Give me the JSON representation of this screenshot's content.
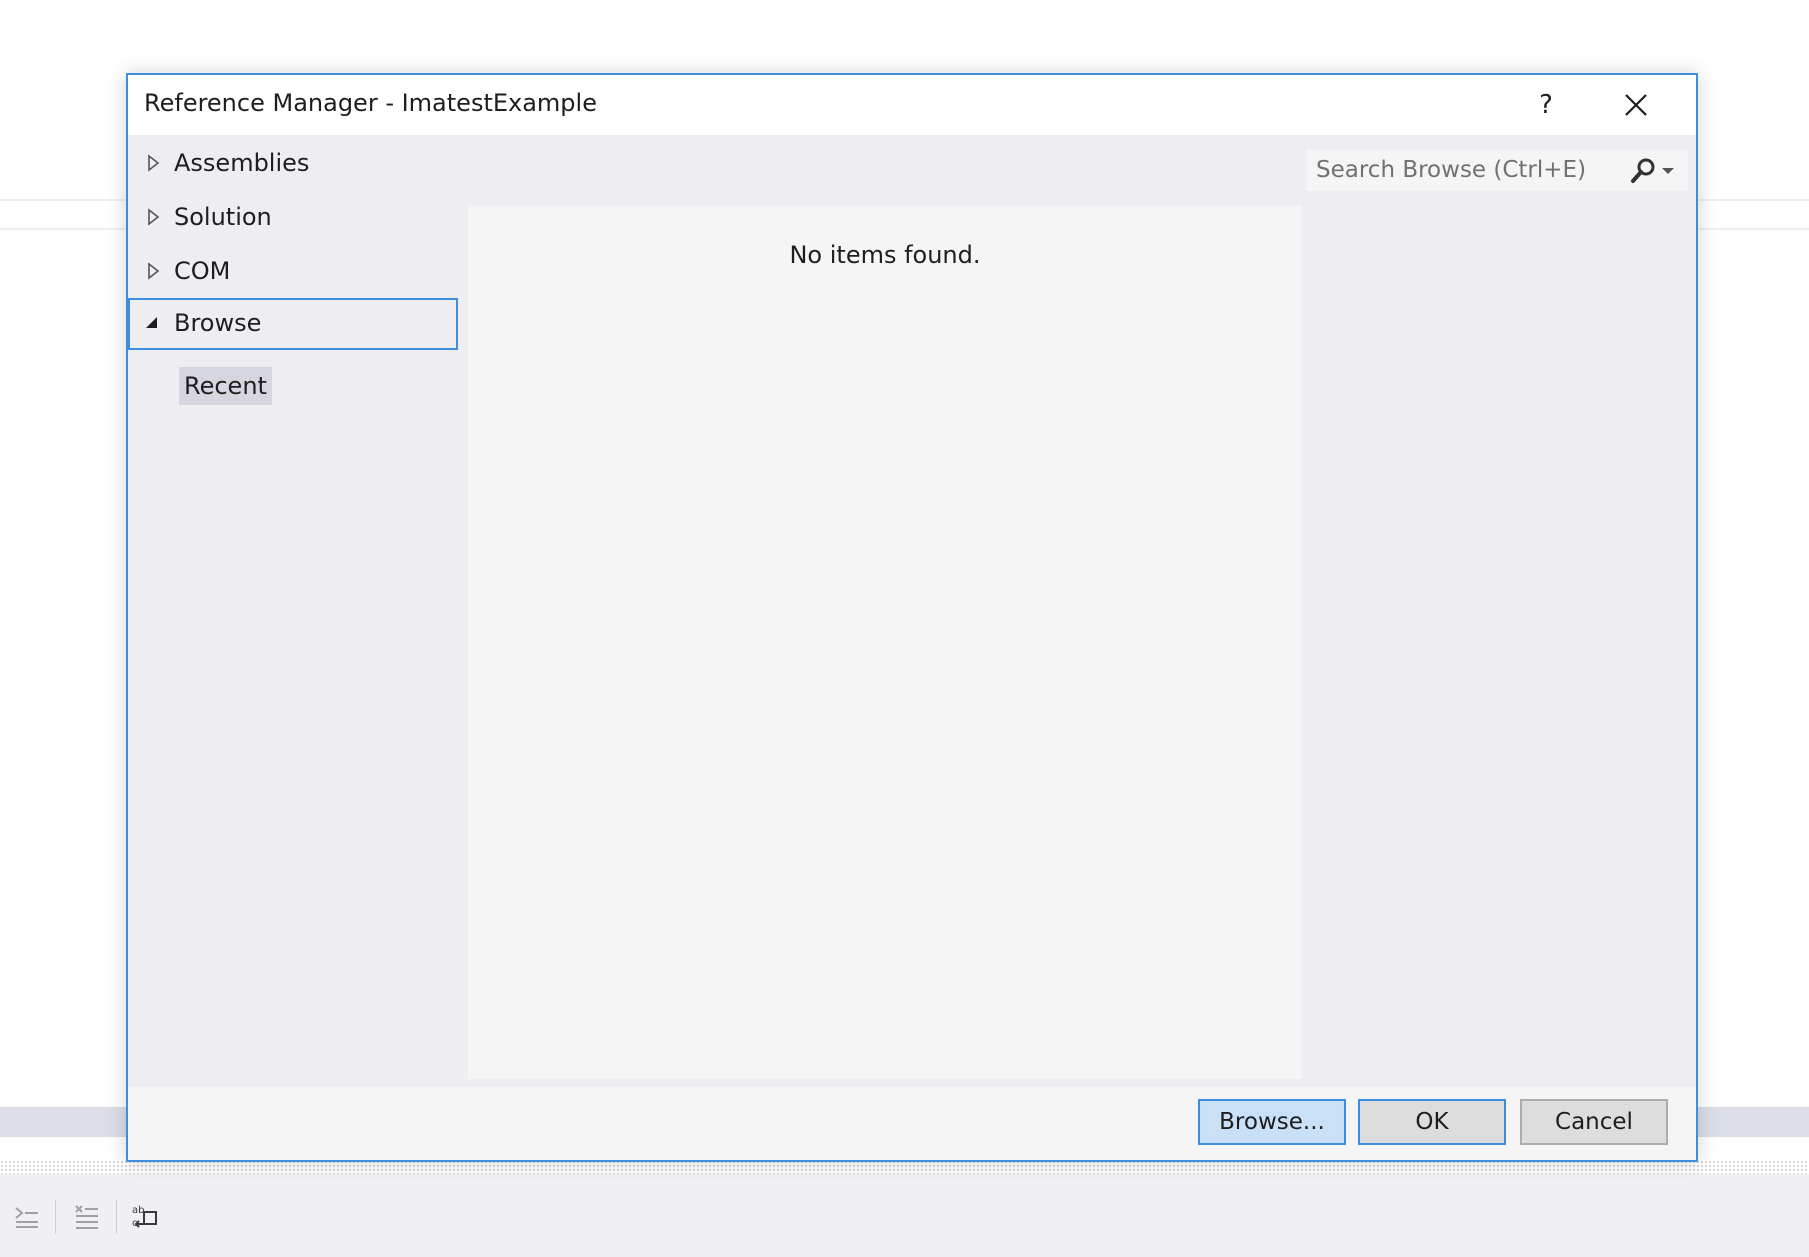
{
  "dialog": {
    "title": "Reference Manager - ImatestExample",
    "help_label": "?"
  },
  "nav": {
    "items": [
      {
        "label": "Assemblies",
        "expanded": false
      },
      {
        "label": "Solution",
        "expanded": false
      },
      {
        "label": "COM",
        "expanded": false
      },
      {
        "label": "Browse",
        "expanded": true,
        "selected": true
      }
    ],
    "subitem": {
      "label": "Recent"
    }
  },
  "content": {
    "empty_message": "No items found."
  },
  "search": {
    "placeholder": "Search Browse (Ctrl+E)",
    "value": ""
  },
  "footer": {
    "browse_label": "Browse...",
    "ok_label": "OK",
    "cancel_label": "Cancel"
  },
  "colors": {
    "accent": "#3c8fdc",
    "dialog_bg": "#eeeef2",
    "content_bg": "#f5f5f5",
    "primary_button_bg": "#c9e0f7"
  },
  "toolbar": {
    "icons": [
      "indent-icon",
      "list-format-icon",
      "replace-text-icon"
    ]
  }
}
